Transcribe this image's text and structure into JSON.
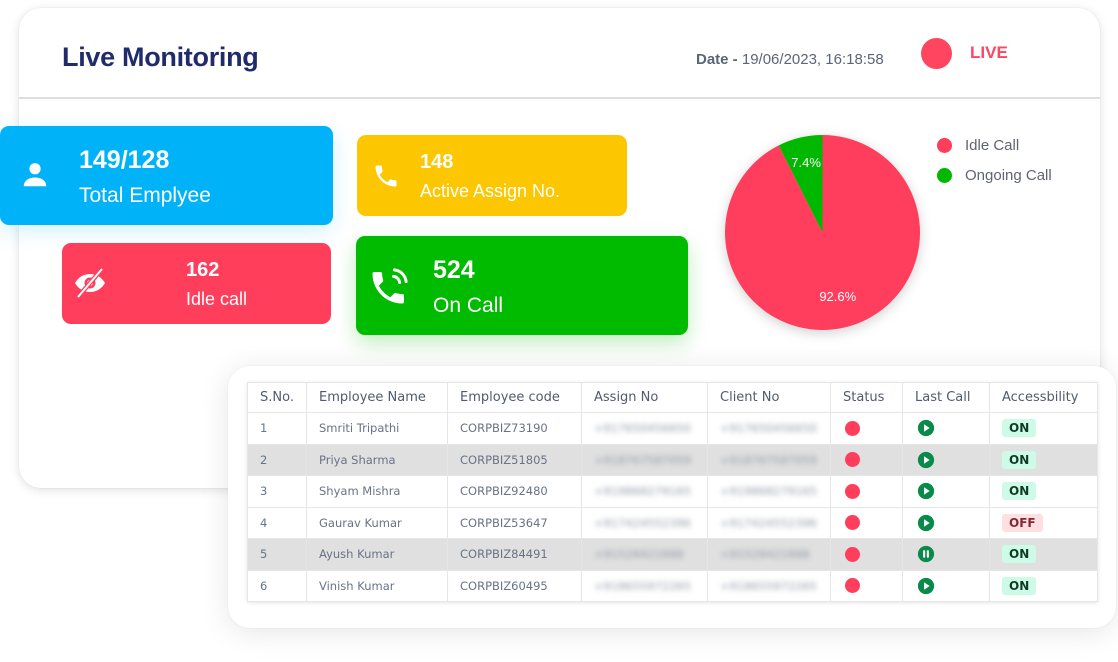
{
  "header": {
    "title": "Live Monitoring",
    "date_label": "Date -",
    "date_value": "19/06/2023, 16:18:58",
    "live_label": "LIVE"
  },
  "colors": {
    "accent_live": "#ff4560",
    "total_card": "#00b3f8",
    "idle_card": "#ff3e5c",
    "assign_card": "#fcc600",
    "oncall_card": "#00bb00",
    "badge_on_bg": "#cdfbe8",
    "badge_off_bg": "#ffdfe2"
  },
  "cards": {
    "total": {
      "value": "149/128",
      "label": "Total Emplyee",
      "icon": "user-icon"
    },
    "idle": {
      "value": "162",
      "label": "Idle call",
      "icon": "eye-slash-icon"
    },
    "assign": {
      "value": "148",
      "label": "Active Assign No.",
      "icon": "phone-icon"
    },
    "oncall": {
      "value": "524",
      "label": "On Call",
      "icon": "phone-volume-icon"
    }
  },
  "chart_data": {
    "type": "pie",
    "title": "",
    "slices": [
      {
        "name": "Idle Call",
        "value": 92.6,
        "label": "92.6%",
        "color": "#ff3e5c"
      },
      {
        "name": "Ongoing Call",
        "value": 7.4,
        "label": "7.4%",
        "color": "#00b800"
      }
    ],
    "legend": [
      "Idle Call",
      "Ongoing Call"
    ],
    "legend_position": "top-right"
  },
  "table": {
    "headers": [
      "S.No.",
      "Employee Name",
      "Employee code",
      "Assign No",
      "Client No",
      "Status",
      "Last Call",
      "Accessbility"
    ],
    "rows": [
      {
        "sno": "1",
        "name": "Smriti Tripathi",
        "code": "CORPBIZ73190",
        "assign": "+917650456650",
        "client": "+917650456650",
        "status": "red",
        "last_call": "play",
        "access": "ON",
        "shaded": false
      },
      {
        "sno": "2",
        "name": "Priya Sharma",
        "code": "CORPBIZ51805",
        "assign": "+918767587059",
        "client": "+918767587059",
        "status": "red",
        "last_call": "play",
        "access": "ON",
        "shaded": true
      },
      {
        "sno": "3",
        "name": "Shyam Mishra",
        "code": "CORPBIZ92480",
        "assign": "+919868279165",
        "client": "+919868279165",
        "status": "red",
        "last_call": "play",
        "access": "ON",
        "shaded": false
      },
      {
        "sno": "4",
        "name": "Gaurav Kumar",
        "code": "CORPBIZ53647",
        "assign": "+917424552396",
        "client": "+917424552396",
        "status": "red",
        "last_call": "play",
        "access": "OFF",
        "shaded": false
      },
      {
        "sno": "5",
        "name": "Ayush Kumar",
        "code": "CORPBIZ84491",
        "assign": "+91528421888",
        "client": "+91528421888",
        "status": "red",
        "last_call": "pause",
        "access": "ON",
        "shaded": true
      },
      {
        "sno": "6",
        "name": "Vinish Kumar",
        "code": "CORPBIZ60495",
        "assign": "+918655972265",
        "client": "+918655972265",
        "status": "red",
        "last_call": "play",
        "access": "ON",
        "shaded": false
      }
    ]
  }
}
